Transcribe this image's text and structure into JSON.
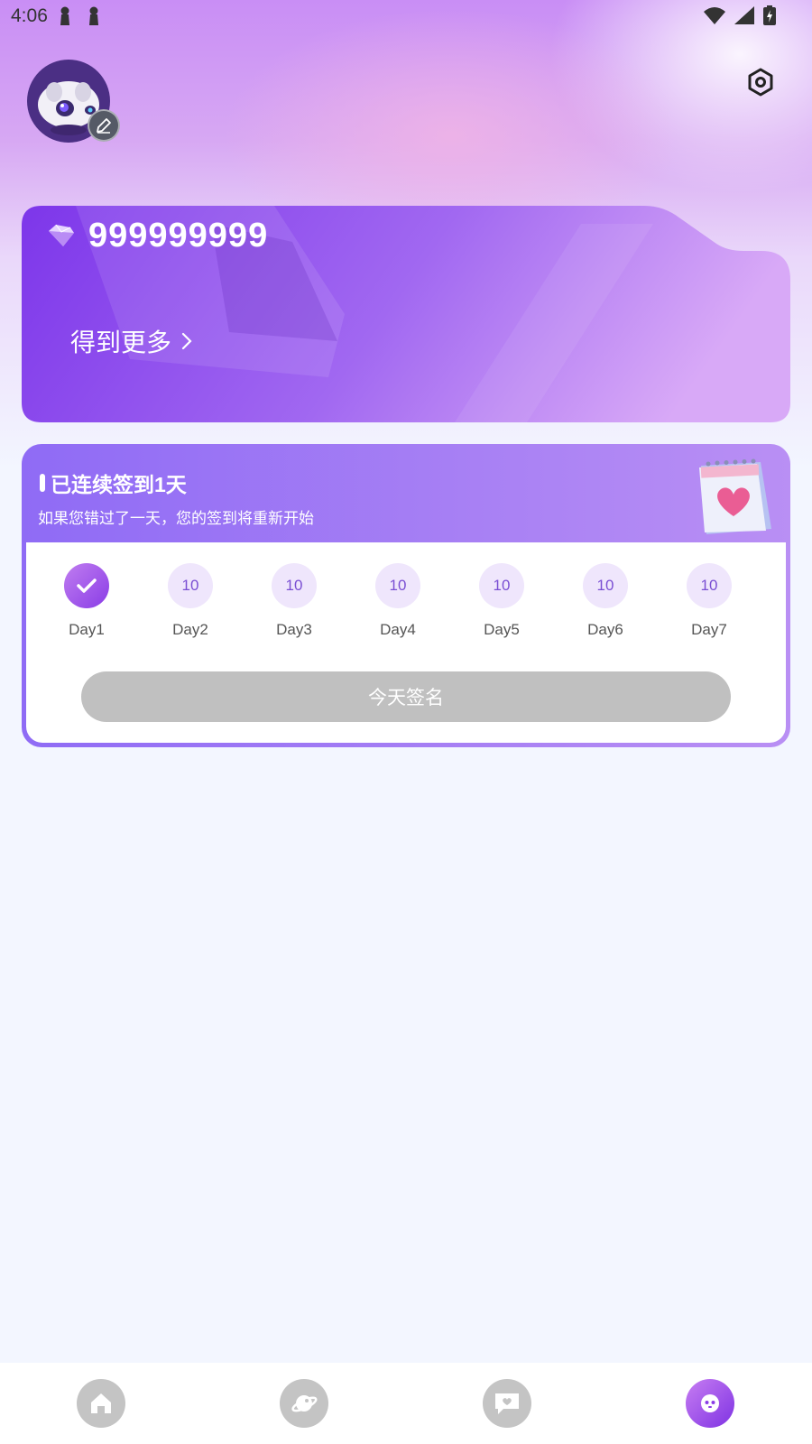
{
  "status_bar": {
    "time": "4:06"
  },
  "profile": {
    "avatar": "avatar",
    "edit_icon": "edit-icon",
    "settings_icon": "settings-icon"
  },
  "wallet": {
    "gem_icon": "gem-icon",
    "balance": "999999999",
    "get_more_label": "得到更多",
    "get_more_icon": "chevron-right-icon"
  },
  "signin": {
    "title": "已连续签到1天",
    "subtitle": "如果您错过了一天，您的签到将重新开始",
    "days": [
      {
        "label": "Day1",
        "reward": "",
        "status": "checked"
      },
      {
        "label": "Day2",
        "reward": "10",
        "status": "pending"
      },
      {
        "label": "Day3",
        "reward": "10",
        "status": "pending"
      },
      {
        "label": "Day4",
        "reward": "10",
        "status": "pending"
      },
      {
        "label": "Day5",
        "reward": "10",
        "status": "pending"
      },
      {
        "label": "Day6",
        "reward": "10",
        "status": "pending"
      },
      {
        "label": "Day7",
        "reward": "10",
        "status": "pending"
      }
    ],
    "button_label": "今天签名"
  },
  "bottom_nav": {
    "items": [
      {
        "icon": "home-icon",
        "active": false
      },
      {
        "icon": "planet-icon",
        "active": false
      },
      {
        "icon": "chat-heart-icon",
        "active": false
      },
      {
        "icon": "profile-mascot-icon",
        "active": true
      }
    ]
  },
  "colors": {
    "accent": "#8a3de6",
    "card_purple": "#9a5cf0",
    "disabled_button": "#c0c0c0",
    "page_bg": "#f3f6ff"
  }
}
